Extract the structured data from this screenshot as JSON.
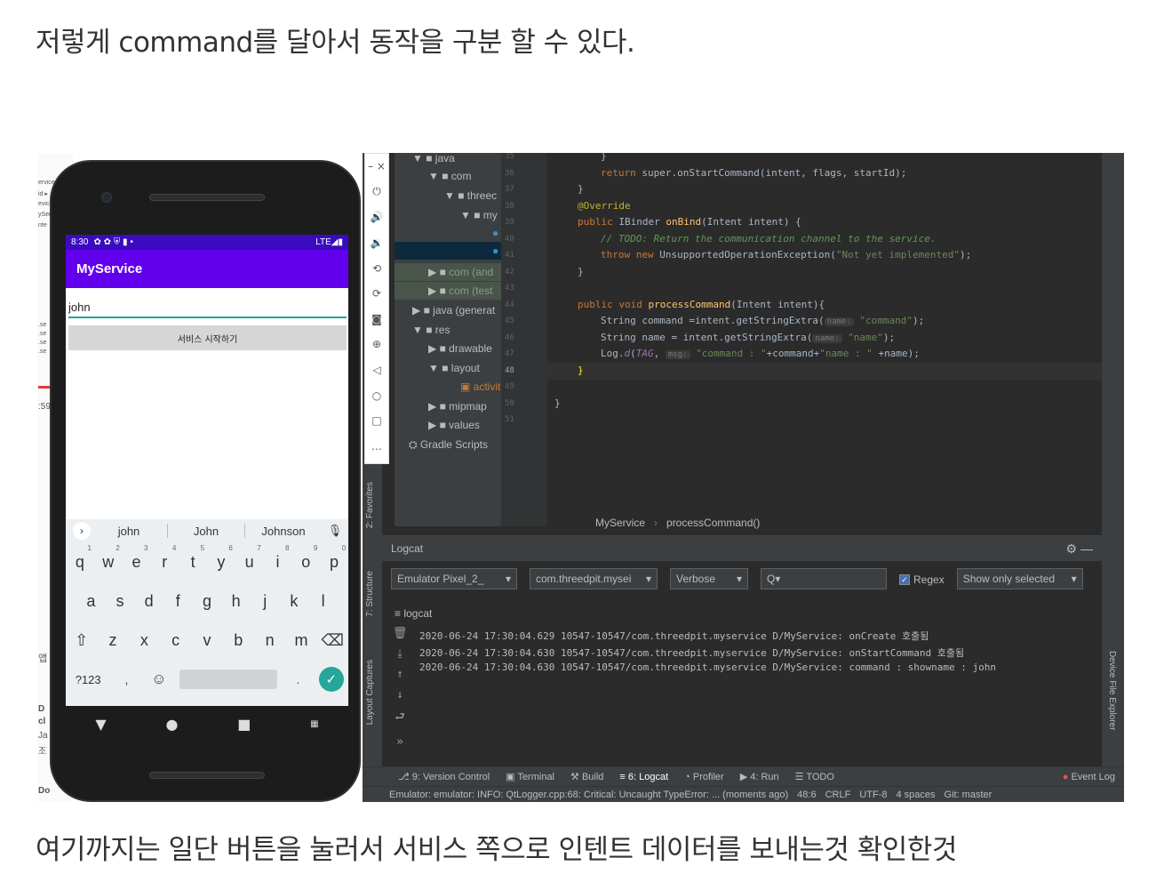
{
  "captions": {
    "top": "저렇게 command를 달아서 동작을 구분 할 수 있다.",
    "bottom": "여기까지는 일단 버튼을 눌러서 서비스 쪽으로 인텐트 데이터를 보내는것 확인한것"
  },
  "phone": {
    "time": "8:30",
    "status_right": "LTE◢▮",
    "app_title": "MyService",
    "input_value": "john",
    "button_label": "서비스 시작하기",
    "suggestions": [
      "john",
      "John",
      "Johnson"
    ],
    "row1": [
      "q",
      "w",
      "e",
      "r",
      "t",
      "y",
      "u",
      "i",
      "o",
      "p"
    ],
    "row1_nums": [
      "1",
      "2",
      "3",
      "4",
      "5",
      "6",
      "7",
      "8",
      "9",
      "0"
    ],
    "row2": [
      "a",
      "s",
      "d",
      "f",
      "g",
      "h",
      "j",
      "k",
      "l"
    ],
    "row3": [
      "⇧",
      "z",
      "x",
      "c",
      "v",
      "b",
      "n",
      "m",
      "⌫"
    ],
    "row4": [
      "?123",
      ",",
      "☺",
      "",
      ".",
      "✓"
    ]
  },
  "tree": {
    "java": "java",
    "com": "com",
    "threec": "threec",
    "my": "my",
    "com_and": "com (and",
    "com_test": "com (test",
    "java_gen": "java (generat",
    "res": "res",
    "drawable": "drawable",
    "layout": "layout",
    "activit": "activit",
    "mipmap": "mipmap",
    "values": "values",
    "gradle": "Gradle Scripts"
  },
  "gutter": [
    "35",
    "36",
    "37",
    "38",
    "39",
    "40",
    "41",
    "42",
    "43",
    "44",
    "45",
    "46",
    "47",
    "48",
    "49",
    "50",
    "51"
  ],
  "breadcrumb": {
    "cls": "MyService",
    "method": "processCommand()"
  },
  "logcat": {
    "title": "Logcat",
    "device": "Emulator Pixel_2_",
    "package": "com.threedpit.mysei",
    "level": "Verbose",
    "search": "Q▾",
    "regex": "Regex",
    "only_selected": "Show only selected",
    "tab": "logcat",
    "lines": [
      "2020-06-24 17:30:04.629 10547-10547/com.threedpit.myservice D/MyService: onCreate 호출됨",
      "2020-06-24 17:30:04.630 10547-10547/com.threedpit.myservice D/MyService: onStartCommand 호출됨",
      "2020-06-24 17:30:04.630 10547-10547/com.threedpit.myservice D/MyService: command : showname : john"
    ]
  },
  "side_labels": {
    "favorites": "2: Favorites",
    "structure": "7: Structure",
    "layout_captures": "Layout Captures",
    "device_explorer": "Device File Explorer"
  },
  "bottom_tabs": [
    "9: Version Control",
    "Terminal",
    "Build",
    "6: Logcat",
    "Profiler",
    "4: Run",
    "TODO"
  ],
  "event_log": "Event Log",
  "status_line": {
    "message": "Emulator: emulator: INFO: QtLogger.cpp:68: Critical: Uncaught TypeError: ... (moments ago)",
    "pos": "48:6",
    "crlf": "CRLF",
    "enc": "UTF-8",
    "indent": "4 spaces",
    "git": "Git: master"
  },
  "code": {
    "l35": "}",
    "l36a": "return",
    "l36b": "super.onStartCommand(intent, flags, startId);",
    "l37": "}",
    "l38": "@Override",
    "l39a": "public",
    "l39b": "IBinder",
    "l39c": "onBind",
    "l39d": "(Intent intent) {",
    "l40": "// TODO: Return the communication channel to the service.",
    "l41a": "throw new",
    "l41b": "UnsupportedOperationException(",
    "l41c": "\"Not yet implemented\"",
    "l41d": ");",
    "l42": "}",
    "l44a": "public void",
    "l44b": "processCommand",
    "l44c": "(Intent intent){",
    "l45a": "String command =intent.getStringExtra(",
    "l45h": "name:",
    "l45s": "\"command\"",
    "l45e": ");",
    "l46a": "String name = intent.getStringExtra(",
    "l46h": "name:",
    "l46s": "\"name\"",
    "l46e": ");",
    "l47a": "Log.",
    "l47b": "d",
    "l47c": "(",
    "l47d": "TAG",
    "l47e": ",",
    "l47h": "msg:",
    "l47s": "\"command : \"",
    "l47f": "+command+",
    "l47s2": "\"name : \"",
    "l47g": " +name);",
    "l48": "}",
    "l50": "}"
  }
}
